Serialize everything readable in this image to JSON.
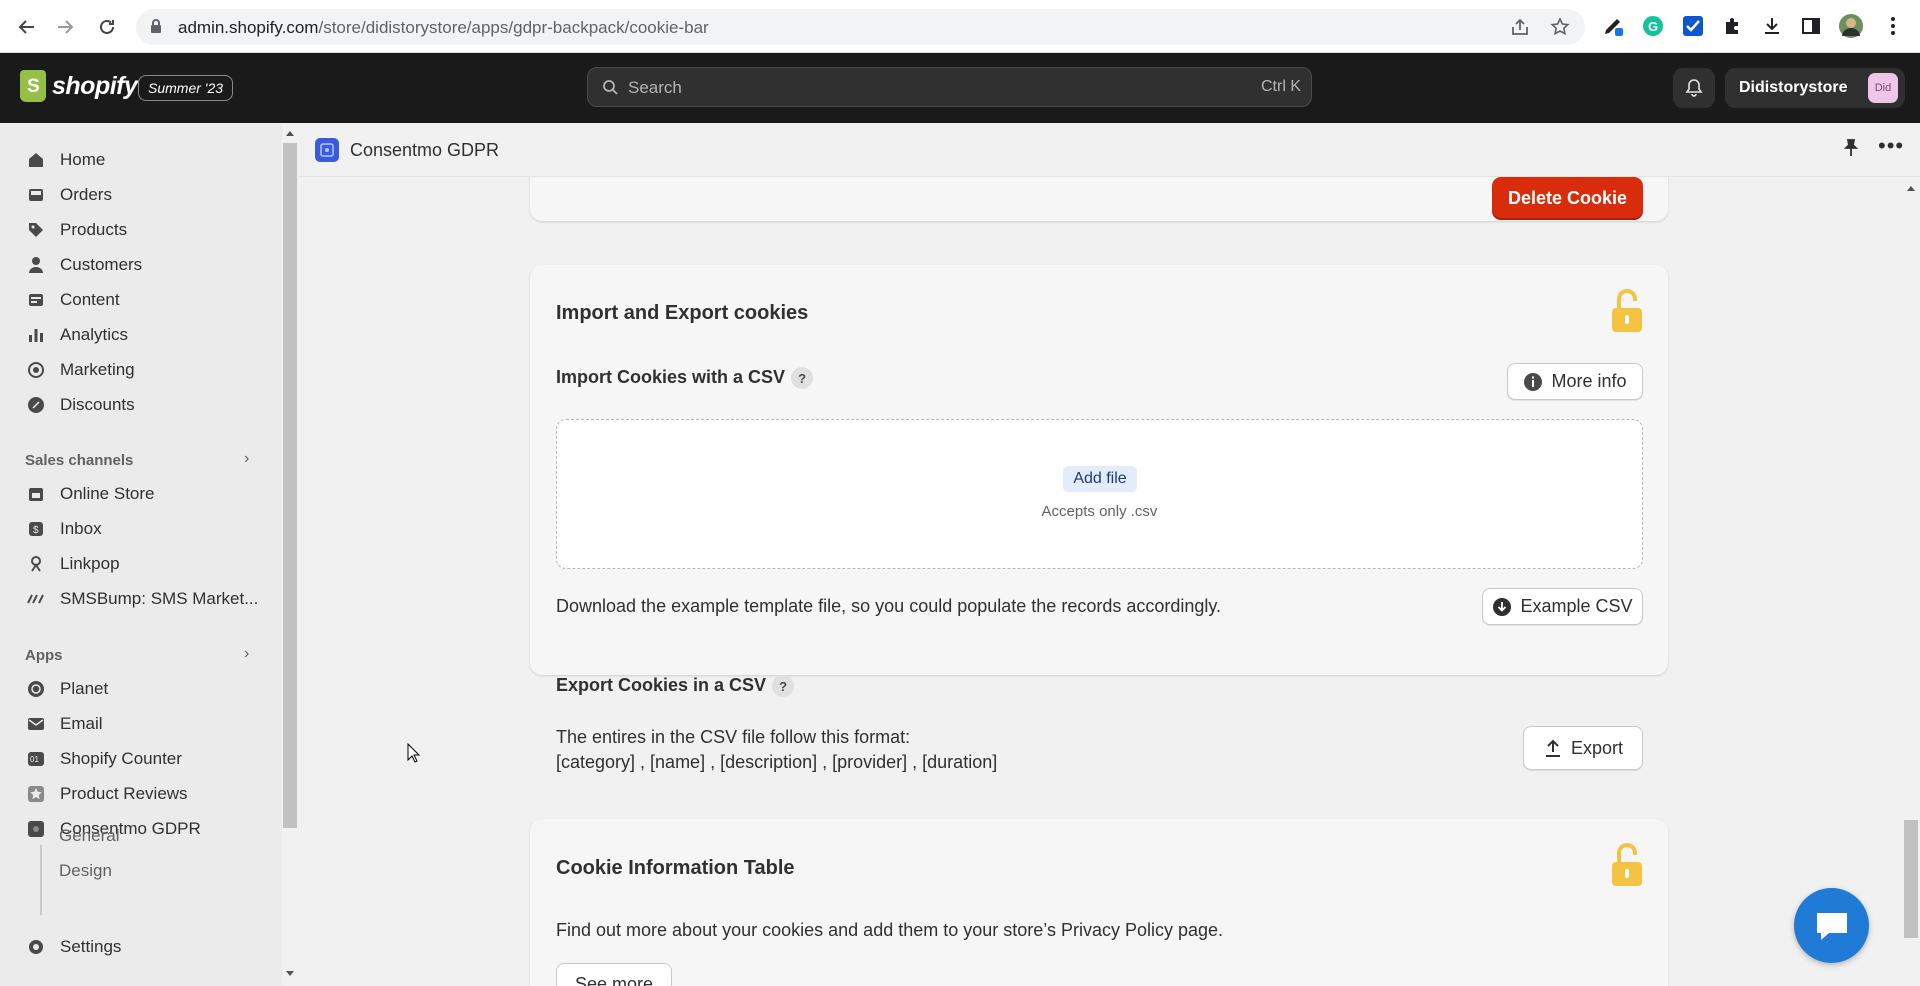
{
  "browser": {
    "url_host": "admin.shopify.com",
    "url_path": "/store/didistorystore/apps/gdpr-backpack/cookie-bar"
  },
  "topbar": {
    "brand": "shopify",
    "season_badge": "Summer '23",
    "search_placeholder": "Search",
    "search_shortcut": "Ctrl K",
    "store_name": "Didistorystore",
    "avatar_initials": "Did"
  },
  "sidebar": {
    "main_items": [
      {
        "label": "Home",
        "icon": "home-icon"
      },
      {
        "label": "Orders",
        "icon": "orders-icon"
      },
      {
        "label": "Products",
        "icon": "tag-icon"
      },
      {
        "label": "Customers",
        "icon": "person-icon"
      },
      {
        "label": "Content",
        "icon": "content-icon"
      },
      {
        "label": "Analytics",
        "icon": "bar-chart-icon"
      },
      {
        "label": "Marketing",
        "icon": "target-icon"
      },
      {
        "label": "Discounts",
        "icon": "discount-icon"
      }
    ],
    "sales_channels_title": "Sales channels",
    "sales_channels": [
      {
        "label": "Online Store",
        "icon": "store-icon"
      },
      {
        "label": "Inbox",
        "icon": "inbox-icon"
      },
      {
        "label": "Linkpop",
        "icon": "linkpop-icon"
      },
      {
        "label": "SMSBump: SMS Market...",
        "icon": "smsbump-icon"
      }
    ],
    "apps_title": "Apps",
    "apps": [
      {
        "label": "Planet",
        "icon": "planet-icon"
      },
      {
        "label": "Email",
        "icon": "email-icon"
      },
      {
        "label": "Shopify Counter",
        "icon": "counter-icon"
      },
      {
        "label": "Product Reviews",
        "icon": "star-icon"
      },
      {
        "label": "Consentmo GDPR",
        "icon": "consentmo-icon"
      }
    ],
    "app_subitems": [
      "General",
      "Design"
    ],
    "settings_label": "Settings"
  },
  "app_header": {
    "title": "Consentmo GDPR"
  },
  "main": {
    "delete_button": "Delete Cookie",
    "import_export": {
      "title": "Import and Export cookies",
      "import_heading": "Import Cookies with a CSV",
      "help_mark": "?",
      "more_info_button": "More info",
      "add_file_button": "Add file",
      "accepts_text": "Accepts only .csv",
      "download_text": "Download the example template file, so you could populate the records accordingly.",
      "example_button": "Example CSV",
      "export_heading": "Export Cookies in a CSV",
      "format_intro": "The entires in the CSV file follow this format:",
      "format_fields": "[category] , [name] , [description] , [provider] , [duration]",
      "export_button": "Export"
    },
    "cookie_table": {
      "title": "Cookie Information Table",
      "description": "Find out more about your cookies and add them to your store’s Privacy Policy page.",
      "see_more_button": "See more"
    }
  },
  "colors": {
    "topbar_bg": "#1a1a1a",
    "danger": "#d82c0d",
    "lock_icon": "#f5c342",
    "chat_bubble": "#1f7bd6"
  }
}
